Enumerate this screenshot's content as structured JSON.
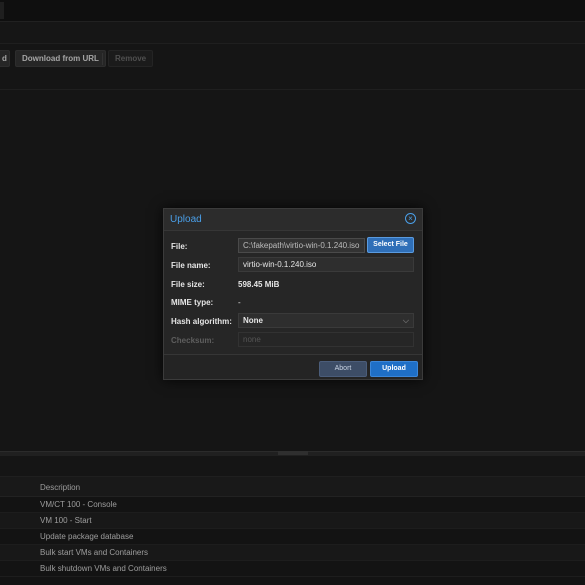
{
  "toolbar": {
    "upload_partial": "d",
    "download_url": "Download from URL",
    "remove": "Remove"
  },
  "dialog": {
    "title": "Upload",
    "labels": {
      "file": "File:",
      "file_name": "File name:",
      "file_size": "File size:",
      "mime_type": "MIME type:",
      "hash_algorithm": "Hash algorithm:",
      "checksum": "Checksum:"
    },
    "file_path": "C:\\fakepath\\virtio-win-0.1.240.iso",
    "select_file": "Select File",
    "file_name": "virtio-win-0.1.240.iso",
    "file_size": "598.45 MiB",
    "mime_type": "-",
    "hash_algorithm": "None",
    "checksum_placeholder": "none",
    "abort": "Abort",
    "upload": "Upload"
  },
  "tasks": {
    "column_description": "Description",
    "rows": [
      "VM/CT 100 - Console",
      "VM 100 - Start",
      "Update package database",
      "Bulk start VMs and Containers",
      "Bulk shutdown VMs and Containers"
    ]
  },
  "colors": {
    "accent": "#4a9fe8",
    "primary_button": "#1f6fc6",
    "background": "#1c1c1c"
  }
}
